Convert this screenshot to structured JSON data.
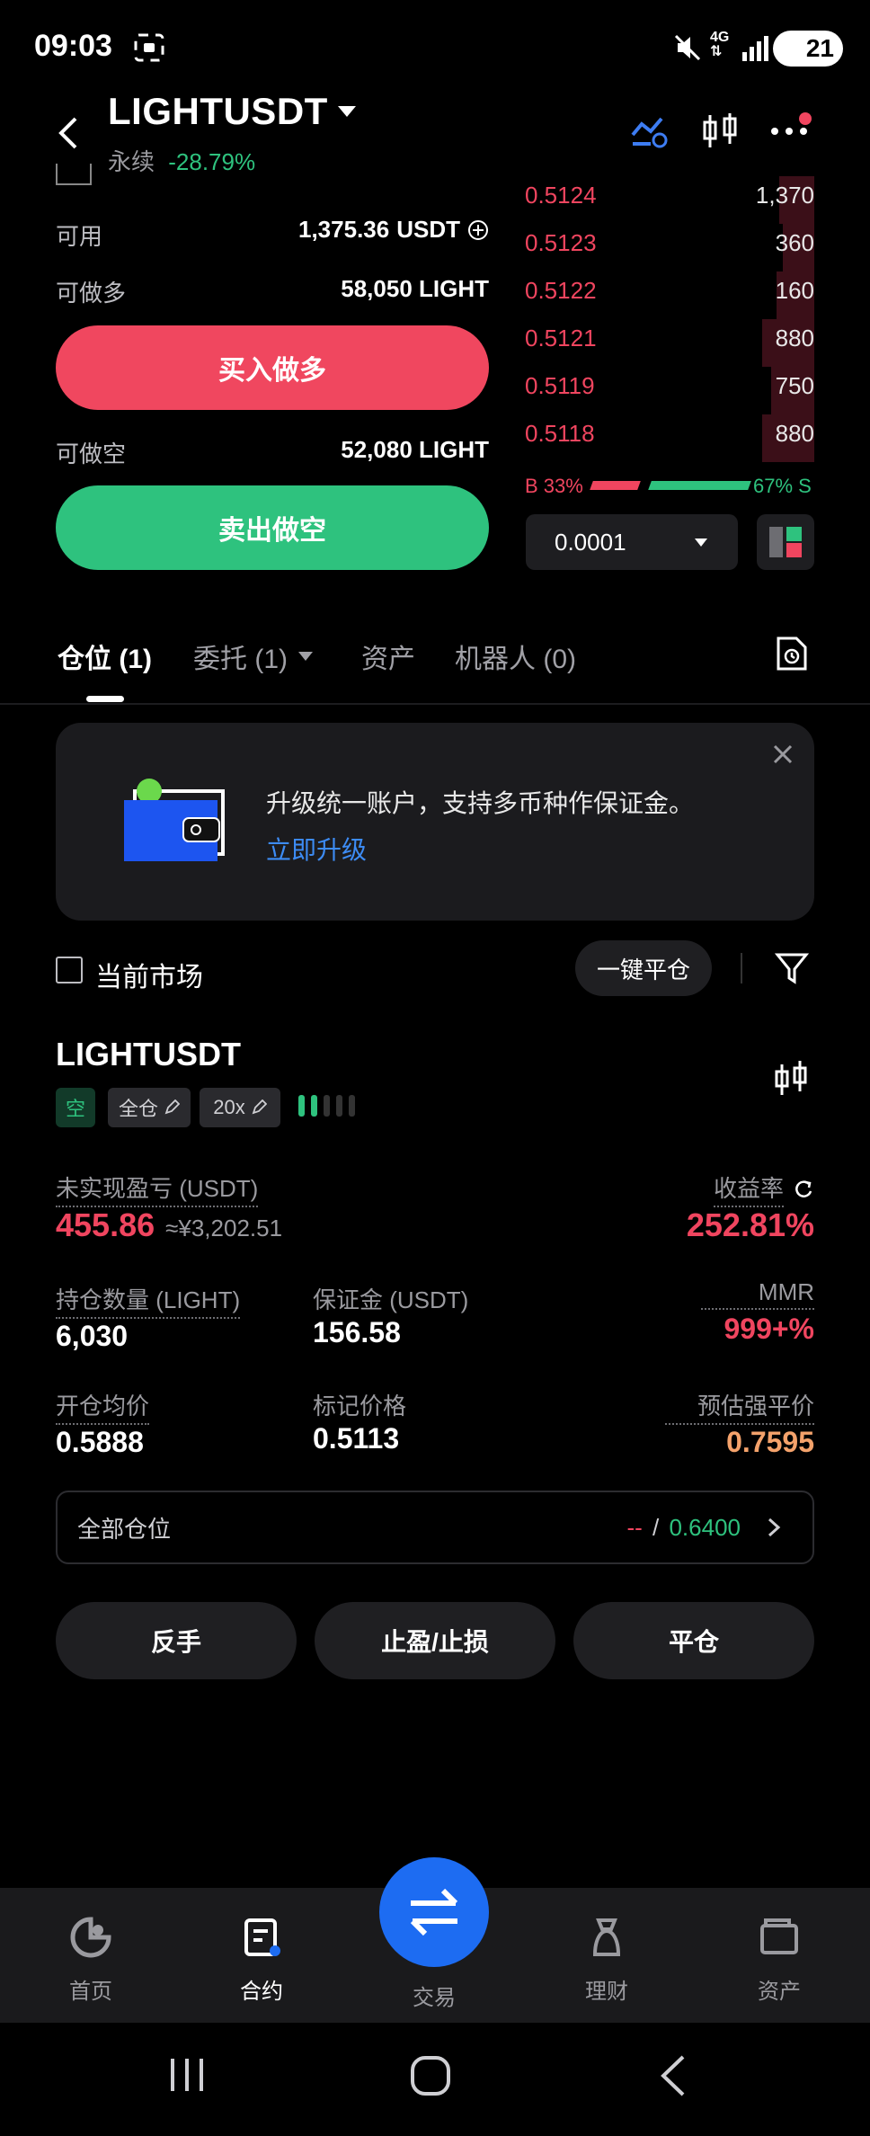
{
  "status_bar": {
    "time": "09:03",
    "battery": "21"
  },
  "header": {
    "title": "LIGHTUSDT",
    "type": "永续",
    "change": "-28.79%"
  },
  "order_panel": {
    "available_label": "可用",
    "available_value": "1,375.36",
    "available_unit": "USDT",
    "can_long_label": "可做多",
    "can_long_value": "58,050 LIGHT",
    "buy_button": "买入做多",
    "can_short_label": "可做空",
    "can_short_value": "52,080 LIGHT",
    "sell_button": "卖出做空"
  },
  "orderbook": {
    "asks": [
      {
        "price": "0.5124",
        "qty": "1,370",
        "depth": 0.12
      },
      {
        "price": "0.5123",
        "qty": "360",
        "depth": 0.11
      },
      {
        "price": "0.5122",
        "qty": "160",
        "depth": 0.13
      },
      {
        "price": "0.5121",
        "qty": "880",
        "depth": 0.18
      },
      {
        "price": "0.5119",
        "qty": "750",
        "depth": 0.15
      },
      {
        "price": "0.5118",
        "qty": "880",
        "depth": 0.18
      }
    ],
    "buy_ratio_label": "B 33%",
    "sell_ratio_label": "67% S",
    "buy_ratio": 0.33,
    "precision": "0.0001"
  },
  "tabs": {
    "positions": "仓位 (1)",
    "orders": "委托 (1)",
    "assets": "资产",
    "bots": "机器人 (0)"
  },
  "banner": {
    "text": "升级统一账户，支持多币种作保证金。",
    "link": "立即升级"
  },
  "filter": {
    "current_market": "当前市场",
    "close_all": "一键平仓"
  },
  "position": {
    "symbol": "LIGHTUSDT",
    "side": "空",
    "margin_mode": "全仓",
    "leverage": "20x",
    "pnl_label": "未实现盈亏 (USDT)",
    "pnl_value": "455.86",
    "pnl_cny": "≈¥3,202.51",
    "roe_label": "收益率",
    "roe_value": "252.81%",
    "size_label": "持仓数量 (LIGHT)",
    "size_value": "6,030",
    "margin_label": "保证金 (USDT)",
    "margin_value": "156.58",
    "mmr_label": "MMR",
    "mmr_value": "999+%",
    "entry_label": "开仓均价",
    "entry_value": "0.5888",
    "mark_label": "标记价格",
    "mark_value": "0.5113",
    "liq_label": "预估强平价",
    "liq_value": "0.7595",
    "all_positions_label": "全部仓位",
    "all_positions_dash": "--",
    "all_positions_slash": " / ",
    "all_positions_value": "0.6400",
    "reverse_button": "反手",
    "tpsl_button": "止盈/止损",
    "close_button": "平仓"
  },
  "bottom_nav": {
    "home": "首页",
    "futures": "合约",
    "trade": "交易",
    "earn": "理财",
    "assets": "资产"
  },
  "colors": {
    "red": "#f0455f",
    "green": "#2ec27e",
    "blue": "#1d6cf2",
    "liq": "#f4a26b"
  }
}
